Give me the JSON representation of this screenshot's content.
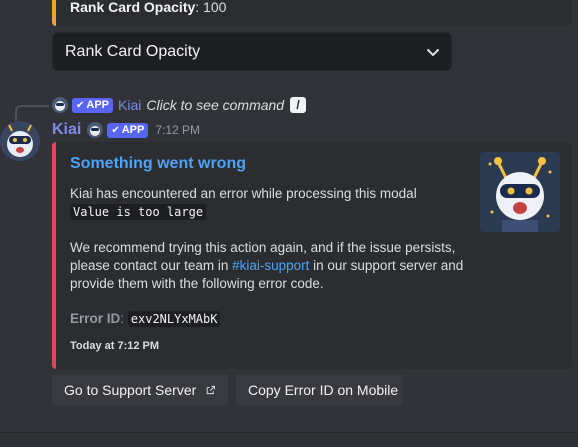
{
  "prev_embed": {
    "field_name": "Rank Card Opacity",
    "field_value": ": 100"
  },
  "select": {
    "value": "Rank Card Opacity",
    "icon": "chevron-down-icon"
  },
  "reply": {
    "badge": "APP",
    "name": "Kiai",
    "text": "Click to see command"
  },
  "message": {
    "username": "Kiai",
    "badge": "APP",
    "timestamp": "7:12 PM"
  },
  "embed": {
    "accent_color": "#e2445c",
    "title": "Something went wrong",
    "line1": "Kiai has encountered an error while processing this modal",
    "code": "Value is too large",
    "p2_pre": "We recommend trying this action again, and if the issue persists, please contact our team in ",
    "channel": "#kiai-support",
    "p2_post": " in our support server and provide them with the following error code.",
    "error_label": "Error ID",
    "error_sep": ": ",
    "error_id": "exv2NLYxMAbK",
    "footer": "Today at 7:12 PM"
  },
  "buttons": {
    "support": "Go to Support Server",
    "support_icon": "external-link-icon",
    "copy": "Copy Error ID on Mobile"
  }
}
